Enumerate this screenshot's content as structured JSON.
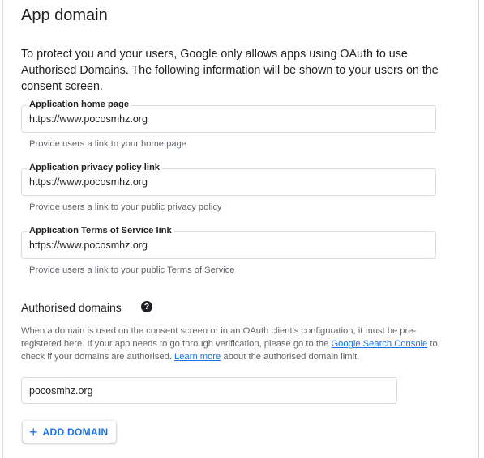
{
  "section": {
    "title": "App domain",
    "intro": "To protect you and your users, Google only allows apps using OAuth to use Authorised Domains. The following information will be shown to your users on the consent screen."
  },
  "fields": [
    {
      "label": "Application home page",
      "value": "https://www.pocosmhz.org",
      "hint": "Provide users a link to your home page"
    },
    {
      "label": "Application privacy policy link",
      "value": "https://www.pocosmhz.org",
      "hint": "Provide users a link to your public privacy policy"
    },
    {
      "label": "Application Terms of Service link",
      "value": "https://www.pocosmhz.org",
      "hint": "Provide users a link to your public Terms of Service"
    }
  ],
  "authorised_domains": {
    "title": "Authorised domains",
    "help_icon": "help-circle-icon",
    "desc_part1": "When a domain is used on the consent screen or in an OAuth client's configuration, it must be pre-registered here. If your app needs to go through verification, please go to the ",
    "link1": "Google Search Console",
    "desc_part2": " to check if your domains are authorised. ",
    "link2": "Learn more",
    "desc_part3": " about the authorised domain limit.",
    "domain_value": "pocosmhz.org",
    "add_button_label": "ADD DOMAIN",
    "add_button_icon": "plus-icon"
  },
  "colors": {
    "accent": "#1a73e8",
    "text": "#202124",
    "hint": "#5f6368",
    "border": "#dadce0"
  }
}
